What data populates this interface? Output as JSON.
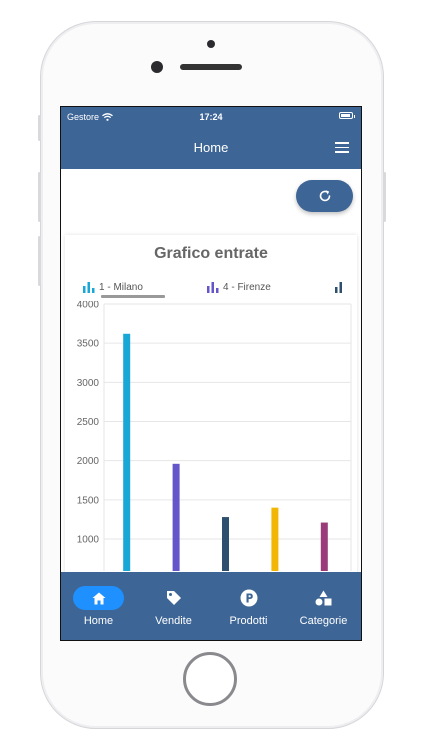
{
  "status": {
    "carrier": "Gestore",
    "time": "17:24",
    "battery_level": 0.9
  },
  "header": {
    "title": "Home"
  },
  "chart_data": {
    "type": "bar",
    "title": "Grafico entrate",
    "legend_tabs": [
      "1 - Milano",
      "4 - Firenze"
    ],
    "categories": [
      "",
      "",
      "",
      "",
      ""
    ],
    "values": [
      3620,
      1960,
      1280,
      1400,
      1210
    ],
    "colors": [
      "#19a7d6",
      "#6455c8",
      "#2e4f6e",
      "#f2b705",
      "#9b3c7a"
    ],
    "yticks": [
      "4000",
      "3500",
      "3000",
      "2500",
      "2000",
      "1500",
      "1000"
    ],
    "ylim": [
      700,
      4000
    ],
    "grid": true
  },
  "tabs": [
    {
      "label": "Home",
      "icon": "home-icon",
      "active": true
    },
    {
      "label": "Vendite",
      "icon": "tag-icon",
      "active": false
    },
    {
      "label": "Prodotti",
      "icon": "p-circle-icon",
      "active": false
    },
    {
      "label": "Categorie",
      "icon": "shapes-icon",
      "active": false
    }
  ],
  "colors": {
    "primary": "#3d6596",
    "active_tab": "#1e90ff"
  }
}
